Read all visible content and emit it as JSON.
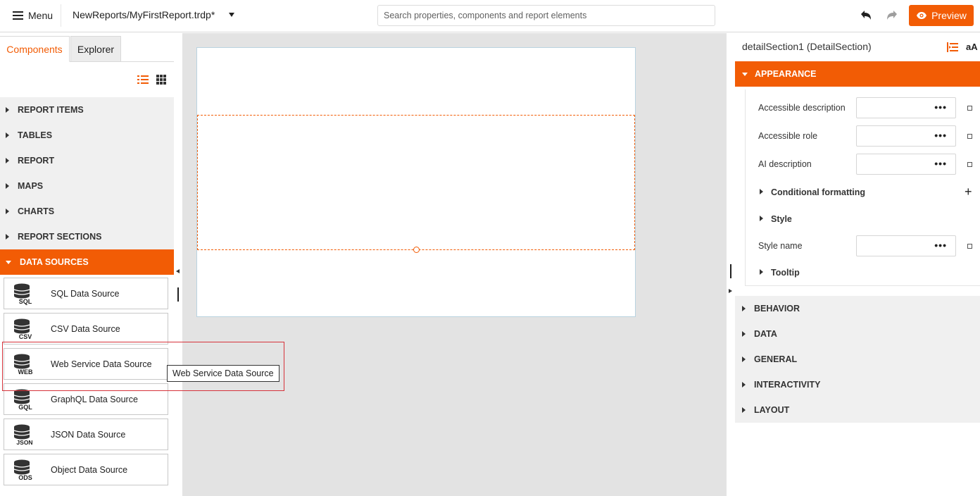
{
  "topbar": {
    "menu_label": "Menu",
    "document_title": "NewReports/MyFirstReport.trdp*",
    "search_placeholder": "Search properties, components and report elements",
    "preview_label": "Preview"
  },
  "left_panel": {
    "tabs": [
      "Components",
      "Explorer"
    ],
    "groups": [
      "REPORT ITEMS",
      "TABLES",
      "REPORT",
      "MAPS",
      "CHARTS",
      "REPORT SECTIONS",
      "DATA SOURCES"
    ],
    "data_sources": [
      {
        "label": "SQL Data Source",
        "icon_text": "SQL"
      },
      {
        "label": "CSV Data Source",
        "icon_text": "CSV"
      },
      {
        "label": "Web Service Data Source",
        "icon_text": "WEB"
      },
      {
        "label": "GraphQL Data Source",
        "icon_text": "GQL"
      },
      {
        "label": "JSON Data Source",
        "icon_text": "JSON"
      },
      {
        "label": "Object Data Source",
        "icon_text": "ODS"
      }
    ]
  },
  "tooltip": {
    "text": "Web Service Data Source"
  },
  "properties": {
    "title": "detailSection1 (DetailSection)",
    "aa_label": "aA",
    "open_category": "APPEARANCE",
    "fields": {
      "accessible_description": "Accessible description",
      "accessible_role": "Accessible role",
      "ai_description": "AI description",
      "conditional_formatting": "Conditional formatting",
      "style": "Style",
      "style_name": "Style name",
      "tooltip": "Tooltip"
    },
    "ellipsis": "•••",
    "plus": "+",
    "categories": [
      "BEHAVIOR",
      "DATA",
      "GENERAL",
      "INTERACTIVITY",
      "LAYOUT"
    ]
  },
  "colors": {
    "accent": "#f25c05",
    "panel_bg": "#f0f0f0",
    "canvas_bg": "#e3e3e3",
    "highlight": "#d6323a"
  }
}
